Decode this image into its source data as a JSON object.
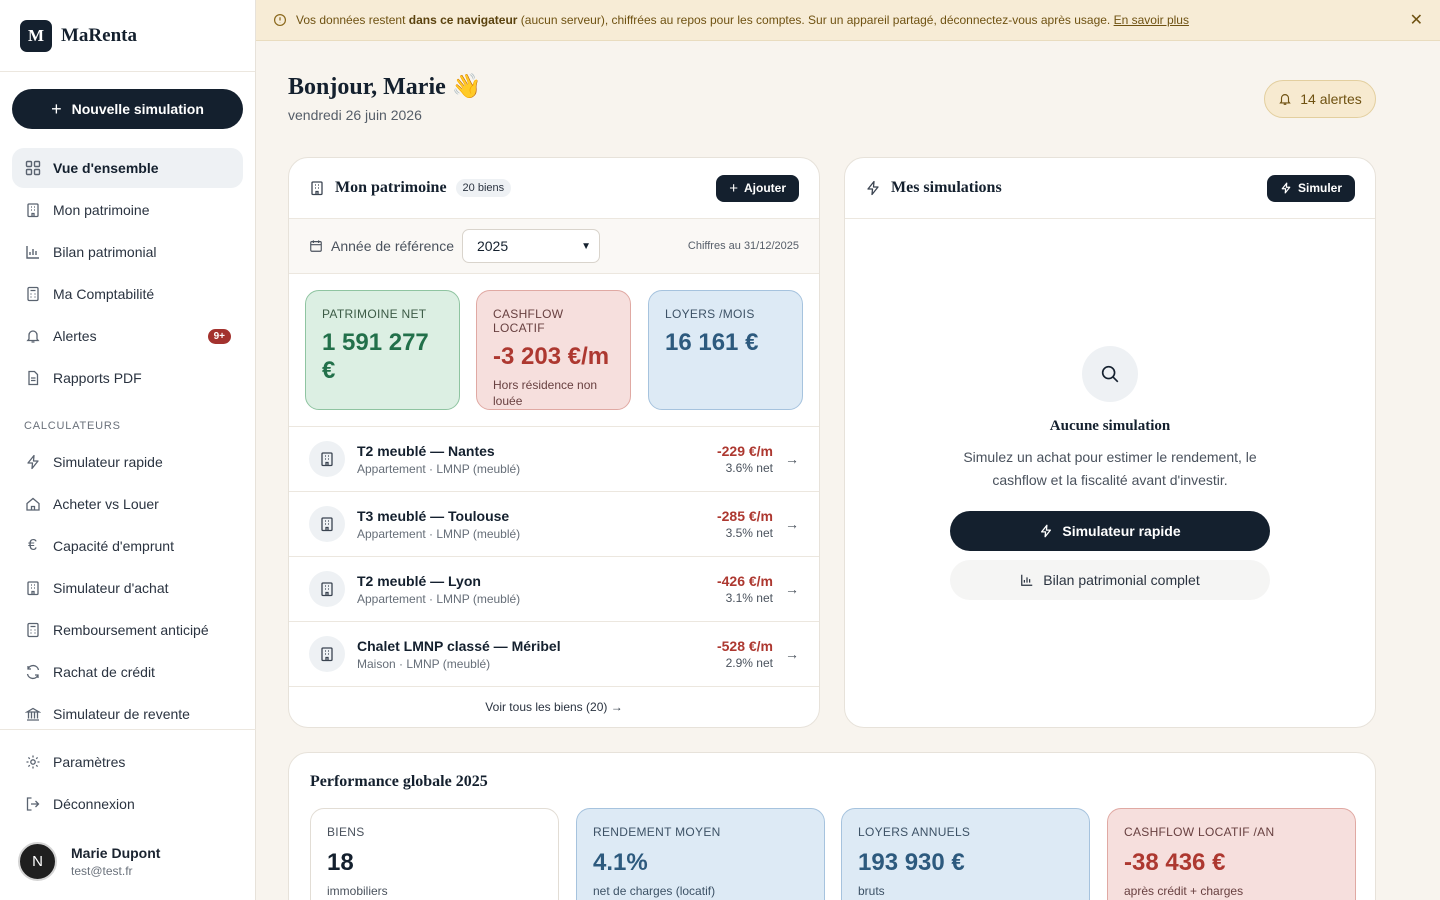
{
  "brand": {
    "logo_letter": "M",
    "name": "MaRenta"
  },
  "sidebar": {
    "new_simulation": "Nouvelle simulation",
    "items": [
      {
        "label": "Vue d'ensemble",
        "icon": "grid-icon",
        "active": true
      },
      {
        "label": "Mon patrimoine",
        "icon": "building-icon"
      },
      {
        "label": "Bilan patrimonial",
        "icon": "bar-chart-icon"
      },
      {
        "label": "Ma Comptabilité",
        "icon": "calculator-icon"
      },
      {
        "label": "Alertes",
        "icon": "bell-icon",
        "badge": "9+"
      },
      {
        "label": "Rapports PDF",
        "icon": "file-icon"
      }
    ],
    "section_label": "CALCULATEURS",
    "calculators": [
      {
        "label": "Simulateur rapide",
        "icon": "bolt-icon"
      },
      {
        "label": "Acheter vs Louer",
        "icon": "home-icon"
      },
      {
        "label": "Capacité d'emprunt",
        "icon": "euro-icon"
      },
      {
        "label": "Simulateur d'achat",
        "icon": "building-icon"
      },
      {
        "label": "Remboursement anticipé",
        "icon": "calculator-icon"
      },
      {
        "label": "Rachat de crédit",
        "icon": "refresh-icon"
      },
      {
        "label": "Simulateur de revente",
        "icon": "bank-icon"
      }
    ],
    "bottom": [
      {
        "label": "Paramètres",
        "icon": "gear-icon"
      },
      {
        "label": "Déconnexion",
        "icon": "logout-icon"
      }
    ],
    "user": {
      "initial": "N",
      "name": "Marie Dupont",
      "email": "test@test.fr"
    }
  },
  "banner": {
    "text_before": "Vos données restent ",
    "bold": "dans ce navigateur",
    "text_after": " (aucun serveur), chiffrées au repos pour les comptes. Sur un appareil partagé, déconnectez-vous après usage. ",
    "link": "En savoir plus",
    "close": "✕"
  },
  "header": {
    "greeting": "Bonjour, Marie 👋",
    "date": "vendredi 26 juin 2026",
    "alerts": "14 alertes"
  },
  "patrimoine": {
    "title": "Mon patrimoine",
    "count_pill": "20 biens",
    "add_button": "Ajouter",
    "year_label": "Année de référence",
    "year_value": "2025",
    "as_of": "Chiffres au 31/12/2025",
    "kpis": [
      {
        "label": "PATRIMOINE NET",
        "value": "1 591 277 €",
        "sub": ""
      },
      {
        "label": "CASHFLOW LOCATIF",
        "value": "-3 203 €/m",
        "sub": "Hors résidence non louée"
      },
      {
        "label": "LOYERS /MOIS",
        "value": "16 161 €",
        "sub": ""
      }
    ],
    "properties": [
      {
        "name": "T2 meublé — Nantes",
        "type": "Appartement · LMNP (meublé)",
        "cashflow": "-229 €/m",
        "yield": "3.6% net"
      },
      {
        "name": "T3 meublé — Toulouse",
        "type": "Appartement · LMNP (meublé)",
        "cashflow": "-285 €/m",
        "yield": "3.5% net"
      },
      {
        "name": "T2 meublé — Lyon",
        "type": "Appartement · LMNP (meublé)",
        "cashflow": "-426 €/m",
        "yield": "3.1% net"
      },
      {
        "name": "Chalet LMNP classé — Méribel",
        "type": "Maison · LMNP (meublé)",
        "cashflow": "-528 €/m",
        "yield": "2.9% net"
      }
    ],
    "see_all": "Voir tous les biens (20) →"
  },
  "simulations": {
    "title": "Mes simulations",
    "simulate_button": "Simuler",
    "empty_title": "Aucune simulation",
    "empty_desc": "Simulez un achat pour estimer le rendement, le cashflow et la fiscalité avant d'investir.",
    "primary_button": "Simulateur rapide",
    "secondary_button": "Bilan patrimonial complet"
  },
  "performance": {
    "title": "Performance globale 2025",
    "kpis": [
      {
        "label": "BIENS",
        "value": "18",
        "sub": "immobiliers"
      },
      {
        "label": "RENDEMENT MOYEN",
        "value": "4.1%",
        "sub": "net de charges (locatif)"
      },
      {
        "label": "LOYERS ANNUELS",
        "value": "193 930 €",
        "sub": "bruts"
      },
      {
        "label": "CASHFLOW LOCATIF /AN",
        "value": "-38 436 €",
        "sub": "après crédit + charges"
      }
    ]
  },
  "colors": {
    "navy": "#14202e",
    "negative": "#ad3830",
    "positive": "#22704a",
    "banner_bg": "#f7ecd6"
  }
}
